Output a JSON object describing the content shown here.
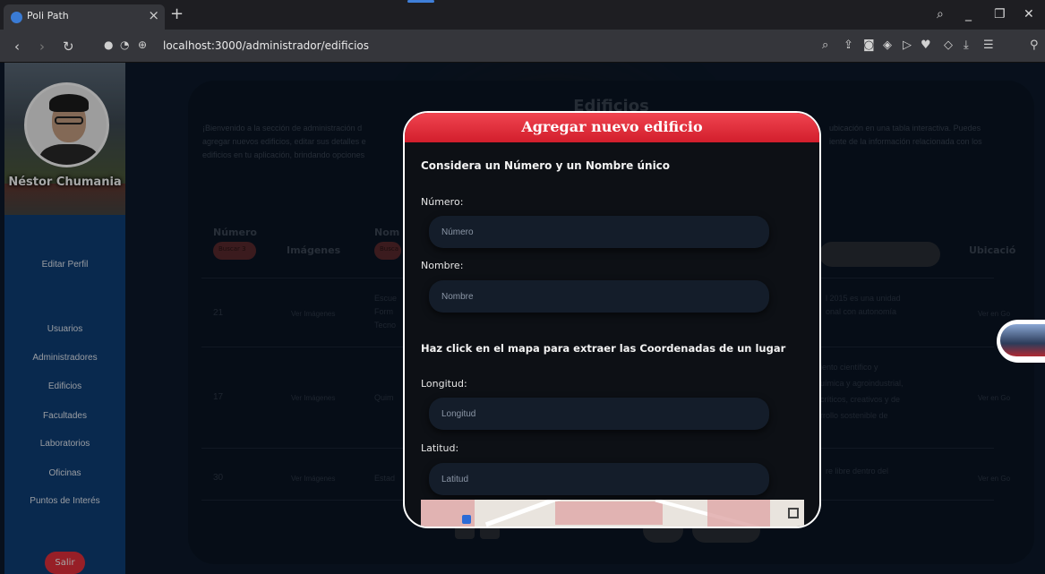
{
  "browser": {
    "tab_title": "Poli Path",
    "tab_close": "×",
    "new_tab": "+",
    "url": "localhost:3000/administrador/edificios"
  },
  "sidebar": {
    "user_name": "Néstor Chumania",
    "edit_profile": "Editar Perfil",
    "items": [
      {
        "label": "Usuarios"
      },
      {
        "label": "Administradores"
      },
      {
        "label": "Edificios"
      },
      {
        "label": "Facultades"
      },
      {
        "label": "Laboratorios"
      },
      {
        "label": "Oficinas"
      },
      {
        "label": "Puntos de Interés"
      }
    ],
    "logout": "Salir"
  },
  "background_card": {
    "title": "Edificios",
    "intro_left": "¡Bienvenido a la sección de administración d",
    "intro_left_2": "agregar nuevos edificios, editar sus detalles e",
    "intro_left_3": "edificios en tu aplicación, brindando opciones",
    "intro_right": "ubicación en una tabla interactiva. Puedes",
    "intro_right_2": "iente de la información relacionada con los",
    "columns": {
      "numero": "Número",
      "imagenes": "Imágenes",
      "nombre": "Nom",
      "ubicacion": "Ubicació"
    },
    "search_num": "Buscar 3",
    "search_name": "Busca",
    "rows": [
      {
        "num": "21",
        "img": "Ver Imágenes",
        "name1": "Escue",
        "name2": "Form",
        "name3": "Tecno",
        "desc1": "l 2015 es una unidad",
        "desc2": "onal con autonomía",
        "loc": "Ver en Go"
      },
      {
        "num": "17",
        "img": "Ver Imágenes",
        "name1": "Quim",
        "desc1": "iento científico y",
        "desc2": "uímica y agroindustrial,",
        "desc3": "críticos, creativos y de",
        "desc4": "rrollo sostenible de",
        "loc": "Ver en Go"
      },
      {
        "num": "30",
        "img": "Ver Imágenes",
        "name1": "Estad",
        "desc1": "re libre dentro del",
        "loc": "Ver en Go"
      }
    ]
  },
  "modal": {
    "title": "Agregar nuevo edificio",
    "subtitle": "Considera un Número y un Nombre único",
    "numero_label": "Número:",
    "numero_placeholder": "Número",
    "nombre_label": "Nombre:",
    "nombre_placeholder": "Nombre",
    "coords_heading": "Haz click en el mapa para extraer las Coordenadas de un lugar",
    "longitud_label": "Longitud:",
    "longitud_placeholder": "Longitud",
    "latitud_label": "Latitud:",
    "latitud_placeholder": "Latitud"
  }
}
